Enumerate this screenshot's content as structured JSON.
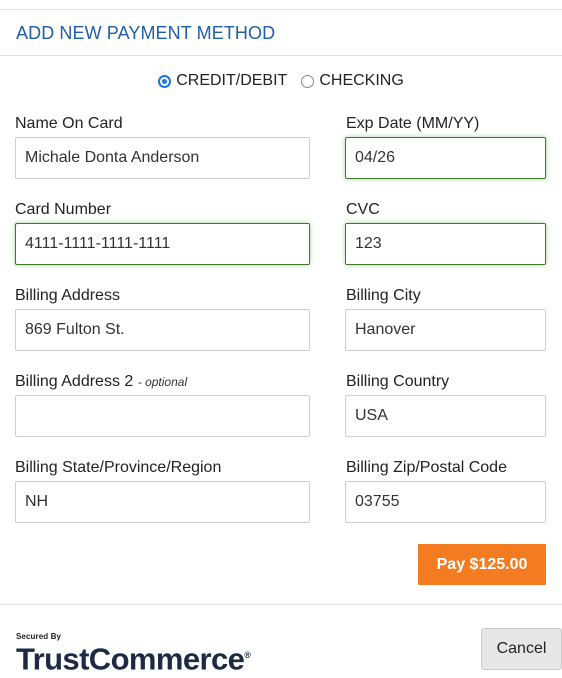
{
  "header": {
    "title": "ADD NEW PAYMENT METHOD"
  },
  "payment_type": {
    "selected": "CREDIT/DEBIT",
    "options": [
      "CREDIT/DEBIT",
      "CHECKING"
    ]
  },
  "form": {
    "name_on_card": {
      "label": "Name On Card",
      "value": "Michale Donta Anderson"
    },
    "exp_date": {
      "label": "Exp Date (MM/YY)",
      "value": "04/26"
    },
    "card_number": {
      "label": "Card Number",
      "value": "4111-1111-1111-1111"
    },
    "cvc": {
      "label": "CVC",
      "value": "123"
    },
    "billing_address": {
      "label": "Billing Address",
      "value": "869 Fulton St."
    },
    "billing_city": {
      "label": "Billing City",
      "value": "Hanover"
    },
    "billing_address2": {
      "label": "Billing Address 2",
      "optional_note": "- optional",
      "value": ""
    },
    "billing_country": {
      "label": "Billing Country",
      "value": "USA"
    },
    "billing_state": {
      "label": "Billing State/Province/Region",
      "value": "NH"
    },
    "billing_zip": {
      "label": "Billing Zip/Postal Code",
      "value": "03755"
    }
  },
  "actions": {
    "pay_label": "Pay $125.00",
    "cancel_label": "Cancel"
  },
  "brand": {
    "secured_by": "Secured By",
    "name": "TrustCommerce",
    "reg": "®"
  },
  "colors": {
    "title": "#1f5fa8",
    "pay_button": "#f47b20",
    "radio_checked": "#1a73e8",
    "valid_border": "#3c7a2c"
  }
}
